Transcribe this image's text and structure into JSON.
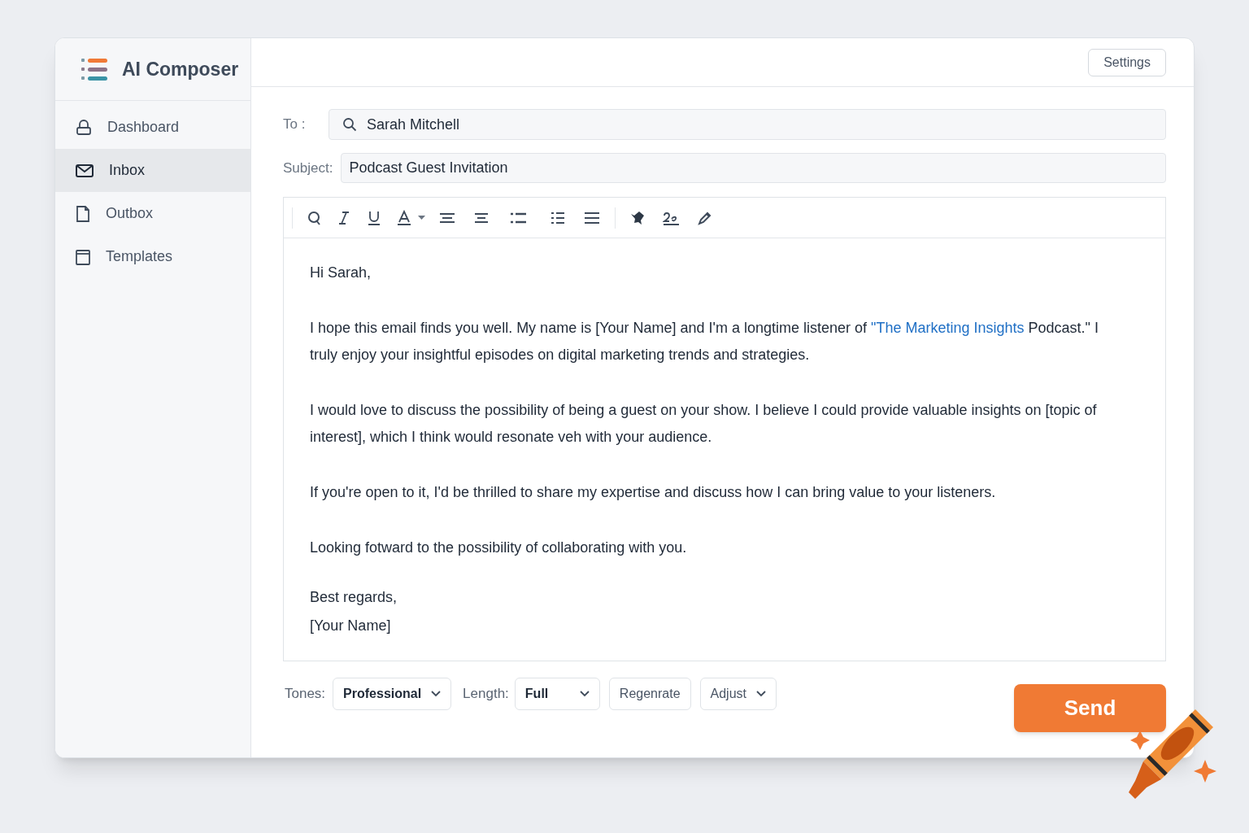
{
  "app": {
    "title": "AI Composer"
  },
  "sidebar": {
    "items": [
      {
        "label": "Dashboard",
        "selected": false
      },
      {
        "label": "Inbox",
        "selected": true
      },
      {
        "label": "Outbox",
        "selected": false
      },
      {
        "label": "Templates",
        "selected": false
      }
    ]
  },
  "header": {
    "settings_button": "Settings"
  },
  "compose": {
    "to_label": "To :",
    "to_value": "Sarah Mitchell",
    "subject_label": "Subject:",
    "subject_value": "Podcast Guest Invitation",
    "paragraphs": [
      [
        {
          "text": "Hi Sarah,"
        }
      ],
      [
        {
          "text": "I hope this email finds you well. My name is [Your Name] and I'm a longtime listener of "
        },
        {
          "text": "\"The Marketing Insights",
          "kind": "link"
        },
        {
          "text": " Podcast.\" I truly enjoy your insightful episodes on digital marketing trends and strategies."
        }
      ],
      [
        {
          "text": "I would love to discuss the possibility of being a guest on your show. I believe I could provide valuable insights on [topic of interest], which I think would resonate veh with your audience."
        }
      ],
      [
        {
          "text": "If you're open to it, I'd be thrilled to share my expertise and discuss how I can bring value to your listeners."
        }
      ],
      [
        {
          "text": "Looking fotward to the possibility of collaborating with you."
        }
      ],
      [
        {
          "text": "Best regards,"
        }
      ],
      [
        {
          "text": "[Your Name]"
        }
      ]
    ]
  },
  "footer": {
    "tones_label": "Tones:",
    "tones_value": "Professional",
    "length_label": "Length:",
    "length_value": "Full",
    "regenerate_button": "Regenrate",
    "adjust_button": "Adjust",
    "send_button": "Send"
  }
}
